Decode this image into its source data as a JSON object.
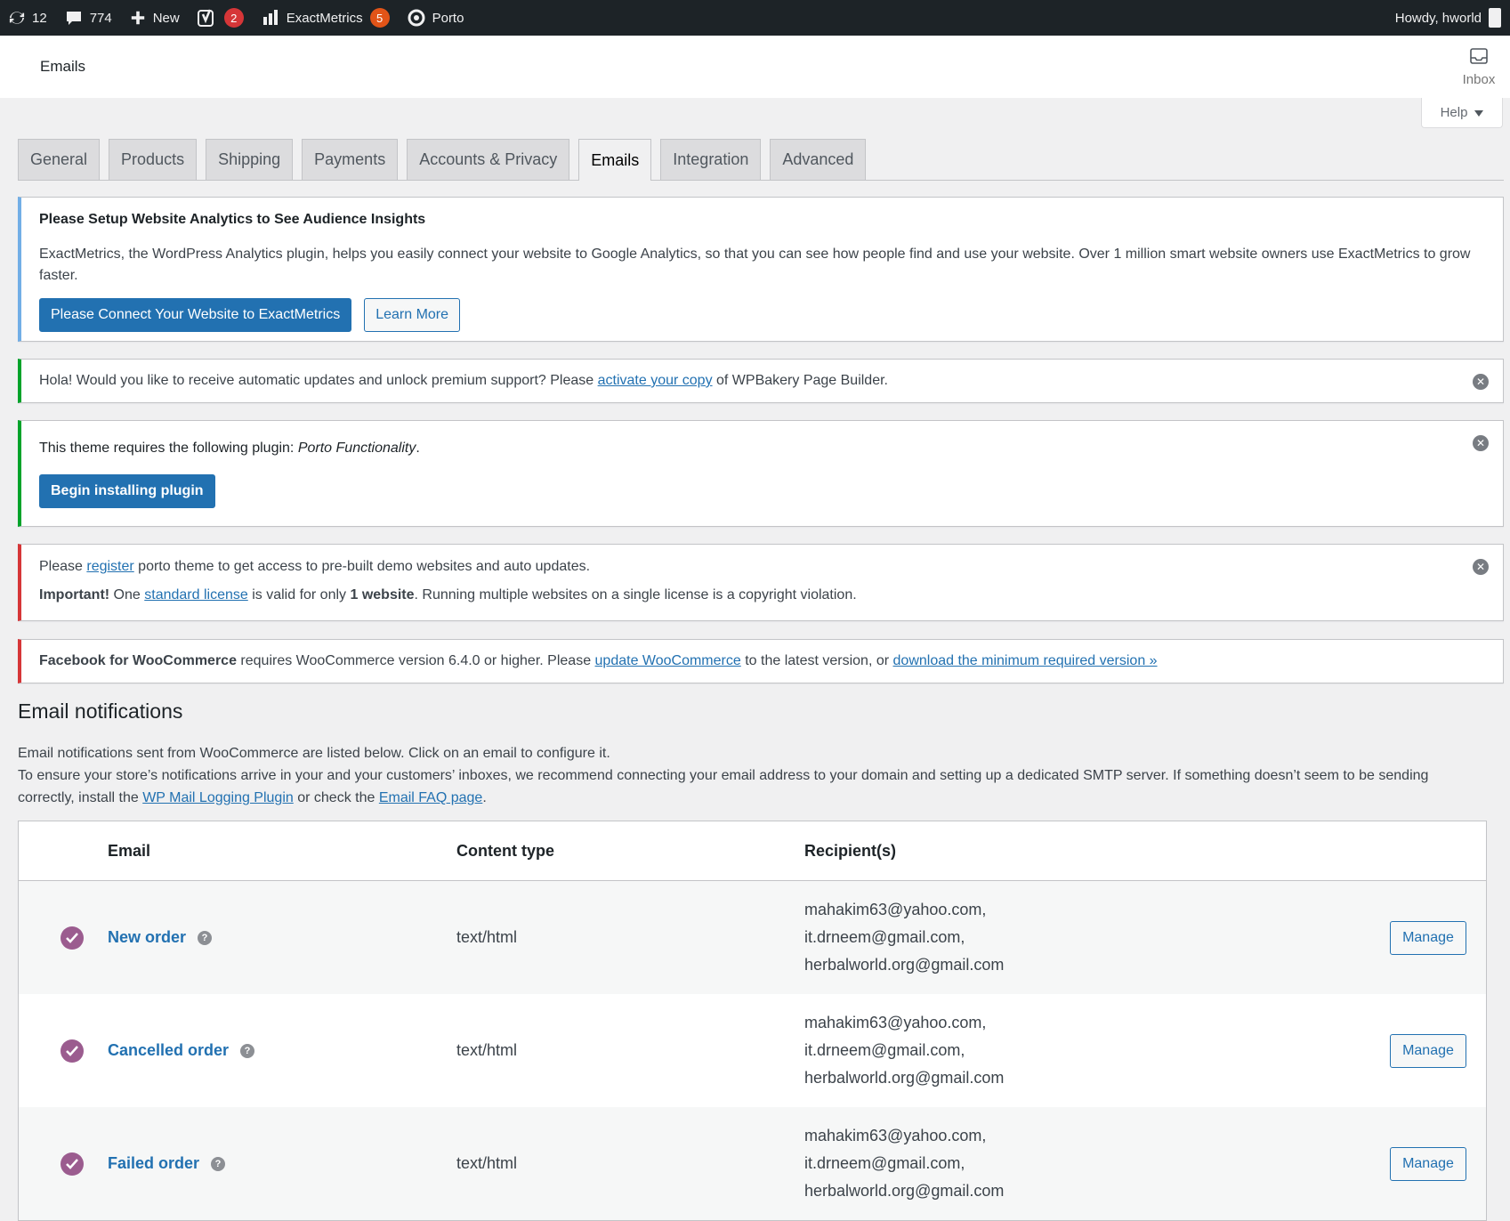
{
  "admin_bar": {
    "updates_count": "12",
    "comments_count": "774",
    "new_label": "New",
    "yoast_badge": "2",
    "exactmetrics_label": "ExactMetrics",
    "exactmetrics_badge": "5",
    "porto_label": "Porto",
    "howdy": "Howdy, hworld"
  },
  "header": {
    "title": "Emails",
    "inbox_label": "Inbox",
    "help_label": "Help"
  },
  "tabs": [
    {
      "label": "General",
      "active": false
    },
    {
      "label": "Products",
      "active": false
    },
    {
      "label": "Shipping",
      "active": false
    },
    {
      "label": "Payments",
      "active": false
    },
    {
      "label": "Accounts & Privacy",
      "active": false
    },
    {
      "label": "Emails",
      "active": true
    },
    {
      "label": "Integration",
      "active": false
    },
    {
      "label": "Advanced",
      "active": false
    }
  ],
  "notices": {
    "analytics": {
      "title": "Please Setup Website Analytics to See Audience Insights",
      "body": "ExactMetrics, the WordPress Analytics plugin, helps you easily connect your website to Google Analytics, so that you can see how people find and use your website. Over 1 million smart website owners use ExactMetrics to grow faster.",
      "primary_button": "Please Connect Your Website to ExactMetrics",
      "secondary_button": "Learn More"
    },
    "wpbakery": {
      "text_before": "Hola! Would you like to receive automatic updates and unlock premium support? Please ",
      "link": "activate your copy",
      "text_after": " of WPBakery Page Builder."
    },
    "plugin_required": {
      "text_before": "This theme requires the following plugin: ",
      "plugin_name": "Porto Functionality",
      "text_after": ".",
      "button": "Begin installing plugin"
    },
    "porto_register": {
      "line1_before": "Please ",
      "line1_link": "register",
      "line1_after": " porto theme to get access to pre-built demo websites and auto updates.",
      "line2_strong": "Important!",
      "line2_a": " One ",
      "line2_link": "standard license",
      "line2_b": " is valid for only ",
      "line2_strong2": "1 website",
      "line2_c": ". Running multiple websites on a single license is a copyright violation."
    },
    "facebook": {
      "strong": "Facebook for WooCommerce",
      "text_a": " requires WooCommerce version 6.4.0 or higher. Please ",
      "link1": "update WooCommerce",
      "text_b": " to the latest version, or ",
      "link2": "download the minimum required version »"
    }
  },
  "email_section": {
    "title": "Email notifications",
    "desc_line1": "Email notifications sent from WooCommerce are listed below. Click on an email to configure it.",
    "desc_line2_a": "To ensure your store’s notifications arrive in your and your customers’ inboxes, we recommend connecting your email address to your domain and setting up a dedicated SMTP server. If something doesn’t seem to be sending correctly, install the ",
    "desc_link1": "WP Mail Logging Plugin",
    "desc_line2_b": " or check the ",
    "desc_link2": "Email FAQ page",
    "desc_line2_c": "."
  },
  "email_table": {
    "headers": {
      "email": "Email",
      "content_type": "Content type",
      "recipients": "Recipient(s)"
    },
    "rows": [
      {
        "name": "New order",
        "content_type": "text/html",
        "recipients": [
          "mahakim63@yahoo.com,",
          "it.drneem@gmail.com,",
          "herbalworld.org@gmail.com"
        ],
        "action": "Manage"
      },
      {
        "name": "Cancelled order",
        "content_type": "text/html",
        "recipients": [
          "mahakim63@yahoo.com,",
          "it.drneem@gmail.com,",
          "herbalworld.org@gmail.com"
        ],
        "action": "Manage"
      },
      {
        "name": "Failed order",
        "content_type": "text/html",
        "recipients": [
          "mahakim63@yahoo.com,",
          "it.drneem@gmail.com,",
          "herbalworld.org@gmail.com"
        ],
        "action": "Manage"
      }
    ]
  },
  "colors": {
    "admin_bar_bg": "#1d2327",
    "link": "#2271b1",
    "woo_purple": "#9b5c8f",
    "badge_red": "#d63638"
  }
}
